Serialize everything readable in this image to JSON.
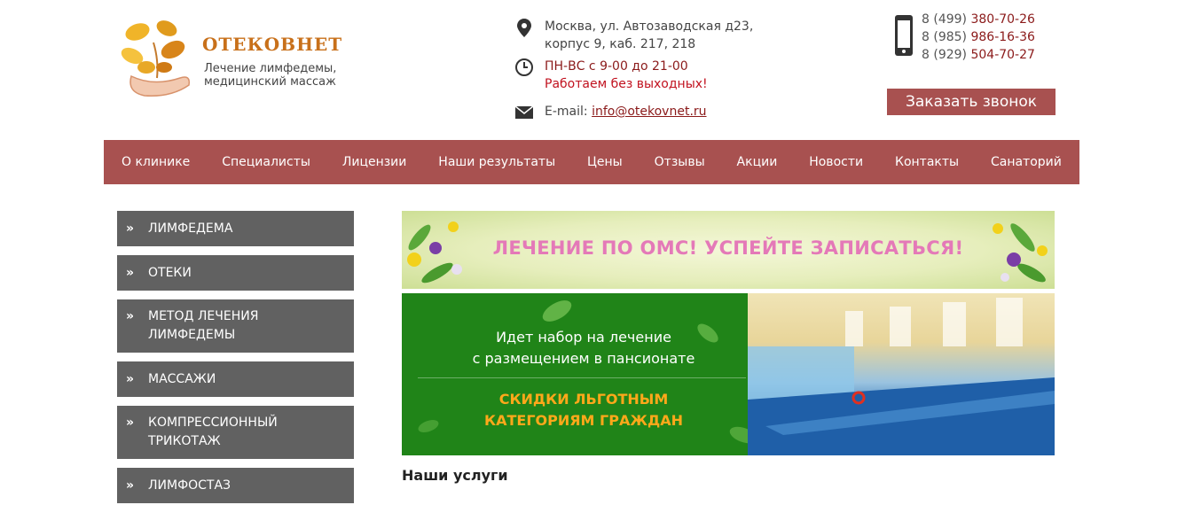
{
  "logo": {
    "brand": "ОТЕКОВНЕТ",
    "tagline": [
      "Лечение лимфедемы,",
      "медицинский массаж"
    ]
  },
  "contact": {
    "address_line1": "Москва, ул. Автозаводская д23,",
    "address_line2": "корпус 9, каб. 217, 218",
    "hours": "ПН-ВС с 9-00 до 21-00",
    "hours_note": "Работаем без выходных!",
    "email_label": "E-mail:",
    "email": "info@otekovnet.ru"
  },
  "phones": [
    {
      "code": "8 (499)",
      "number": "380-70-26"
    },
    {
      "code": "8 (985)",
      "number": "986-16-36"
    },
    {
      "code": "8 (929)",
      "number": "504-70-27"
    }
  ],
  "call_button": "Заказать звонок",
  "nav": [
    "О клинике",
    "Специалисты",
    "Лицензии",
    "Наши результаты",
    "Цены",
    "Отзывы",
    "Акции",
    "Новости",
    "Контакты",
    "Санаторий"
  ],
  "sidebar": [
    [
      "ЛИМФЕДЕМА"
    ],
    [
      "ОТЕКИ"
    ],
    [
      "МЕТОД ЛЕЧЕНИЯ",
      "ЛИМФЕДЕМЫ"
    ],
    [
      "МАССАЖИ"
    ],
    [
      "КОМПРЕССИОННЫЙ",
      "ТРИКОТАЖ"
    ],
    [
      "ЛИМФОСТАЗ"
    ]
  ],
  "banner_omc": "ЛЕЧЕНИЕ ПО ОМС! УСПЕЙТЕ ЗАПИСАТЬСЯ!",
  "banner_pool": {
    "line1": "Идет набор на лечение",
    "line2": "с размещением в пансионате",
    "promo1": "СКИДКИ ЛЬГОТНЫМ",
    "promo2": "КАТЕГОРИЯМ ГРАЖДАН"
  },
  "services_title": "Наши услуги",
  "colors": {
    "accent": "#a85150",
    "sidebar": "#616161",
    "banner_green": "#208418",
    "promo_orange": "#ffa81a",
    "omc_pink": "#e479b8"
  }
}
